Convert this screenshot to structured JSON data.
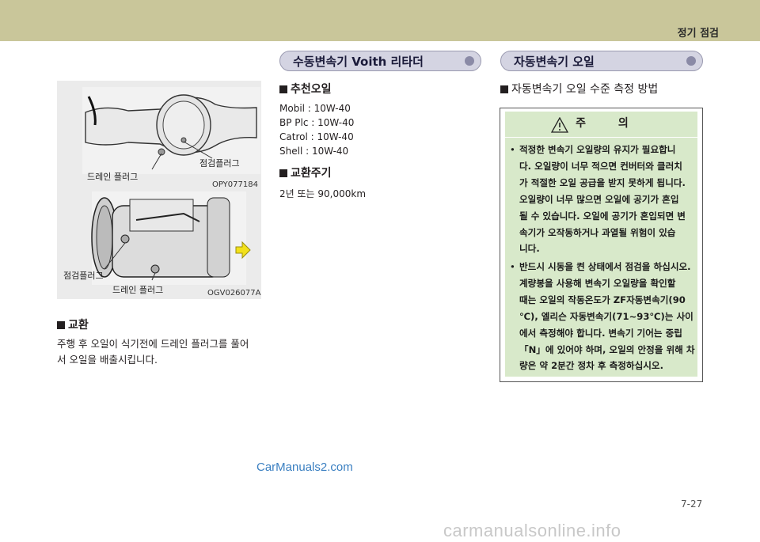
{
  "header": {
    "section": "정기 점검"
  },
  "left": {
    "figure": {
      "upper_labels": {
        "drain": "드레인 플러그",
        "check": "점검플러그",
        "code": "OPY077184"
      },
      "lower_labels": {
        "check": "점검플러그",
        "drain": "드레인 플러그",
        "code": "OGV026077A"
      }
    },
    "replace_title": "교환",
    "replace_text_1": "주행 후 오일이 식기전에 드레인 플러그를 풀어",
    "replace_text_2": "서 오일을 배출시킵니다."
  },
  "middle": {
    "banner": "수동변속기 Voith 리타더",
    "oil_title": "추천오일",
    "oils": [
      "Mobil : 10W-40",
      "BP Plc : 10W-40",
      "Catrol : 10W-40",
      "Shell : 10W-40"
    ],
    "cycle_title": "교환주기",
    "cycle_text": "2년 또는 90,000km"
  },
  "right": {
    "banner": "자동변속기 오일",
    "subtitle": "자동변속기 오일 수준 측정 방법",
    "caution_title": "주 의",
    "bullet1_lines": [
      "적정한 변속기 오일량의 유지가 필요합니",
      "다. 오일량이 너무 적으면 컨버터와 클러치",
      "가 적절한 오일 공급을 받지 못하게 됩니다.",
      "오일량이 너무 많으면 오일에 공기가 혼입",
      "될 수 있습니다. 오일에 공기가 혼입되면 변",
      "속기가 오작동하거나 과열될 위험이 있습",
      "니다."
    ],
    "bullet2_lines": [
      "반드시 시동을 켠 상태에서 점검을 하십시오.",
      "계량봉을 사용해 변속기 오일량을 확인할",
      "때는 오일의 작동온도가 ZF자동변속기(90",
      "℃), 엘리슨 자동변속기(71~93℃)는 사이",
      "에서 측정해야 합니다. 변속기 기어는 중립",
      "「N」에 있어야 하며, 오일의 안정을 위해 차",
      "량은 약 2분간 정차 후 측정하십시오."
    ]
  },
  "page_number": "7-27",
  "watermarks": {
    "top": "CarManuals2.com",
    "bottom": "carmanualsonline.info"
  }
}
